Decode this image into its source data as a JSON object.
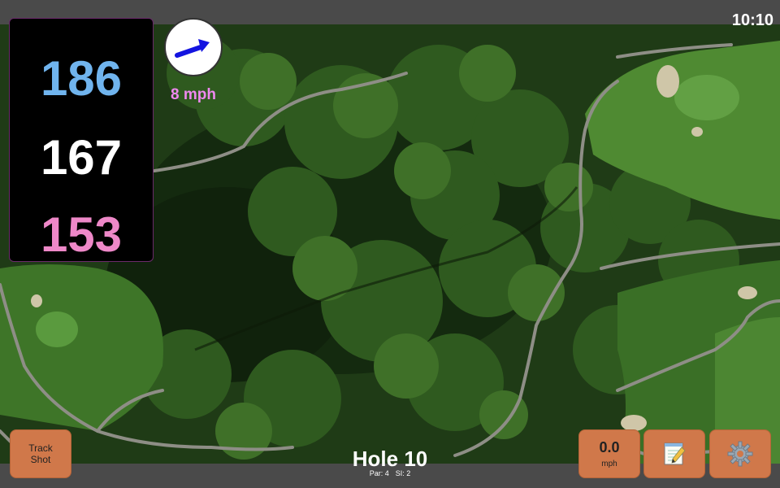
{
  "clock": "10:10",
  "distances": {
    "back": "186",
    "middle": "167",
    "front": "153"
  },
  "wind": {
    "speed": "8 mph",
    "direction_icon": "arrow-icon"
  },
  "buttons": {
    "track_shot_line1": "Track",
    "track_shot_line2": "Shot",
    "speed_value": "0.0",
    "speed_unit": "mph",
    "notes_icon": "📝",
    "settings_icon": "⚙️"
  },
  "hole": {
    "title": "Hole 10",
    "par": "Par: 4",
    "si": "SI: 2"
  },
  "colors": {
    "back_distance": "#70b4ee",
    "middle_distance": "#ffffff",
    "front_distance": "#ee88c8",
    "wind_text": "#ee88ee",
    "button": "#d0784a",
    "bar": "#4a4a4a"
  }
}
